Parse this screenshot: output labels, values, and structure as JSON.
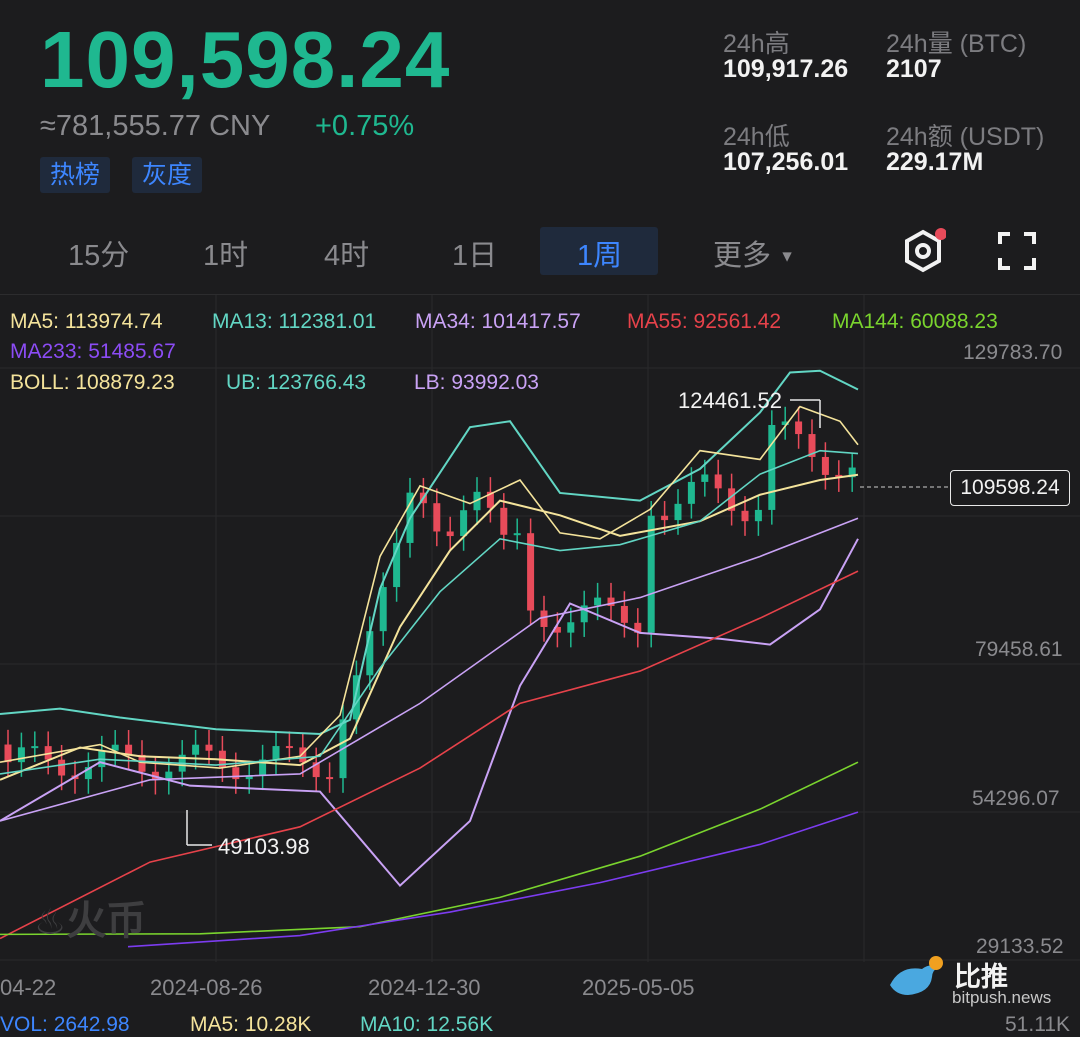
{
  "ticker": {
    "price": "109,598.24",
    "cny": "≈781,555.77 CNY",
    "change": "+0.75%",
    "tags": [
      "热榜",
      "灰度"
    ]
  },
  "stats": {
    "high_label": "24h高",
    "high_value": "109,917.26",
    "vol_label": "24h量 (BTC)",
    "vol_value": "2107",
    "low_label": "24h低",
    "low_value": "107,256.01",
    "amt_label": "24h额 (USDT)",
    "amt_value": "229.17M"
  },
  "timeframes": [
    "15分",
    "1时",
    "4时",
    "1日",
    "1周",
    "更多"
  ],
  "active_timeframe": "1周",
  "indicators": {
    "ma5": "MA5: 113974.74",
    "ma13": "MA13: 112381.01",
    "ma34": "MA34: 101417.57",
    "ma55": "MA55: 92561.42",
    "ma144": "MA144: 60088.23",
    "ma233": "MA233: 51485.67",
    "boll": "BOLL: 108879.23",
    "ub": "UB: 123766.43",
    "lb": "LB: 93992.03"
  },
  "colors": {
    "up": "#1fb890",
    "down": "#e84b5a",
    "ma5": "#f4e39b",
    "ma13": "#62d6c4",
    "ma34": "#c9a2f5",
    "ma55": "#e6424a",
    "ma144": "#7ad42e",
    "ma233": "#7c3cf0",
    "accent": "#3d86ff"
  },
  "axis": {
    "y_labels": [
      "129783.70",
      "79458.61",
      "54296.07",
      "29133.52"
    ],
    "x_labels": [
      "04-22",
      "2024-08-26",
      "2024-12-30",
      "2025-05-05"
    ],
    "high_mark": "124461.52",
    "low_mark": "49103.98",
    "last_price": "109598.24"
  },
  "footer": {
    "vol": "VOL: 2642.98",
    "vma5": "MA5: 10.28K",
    "vma10": "MA10: 12.56K",
    "vmax": "51.11K",
    "watermark": "火币",
    "brand": "比推",
    "brand_url": "bitpush.news"
  }
}
